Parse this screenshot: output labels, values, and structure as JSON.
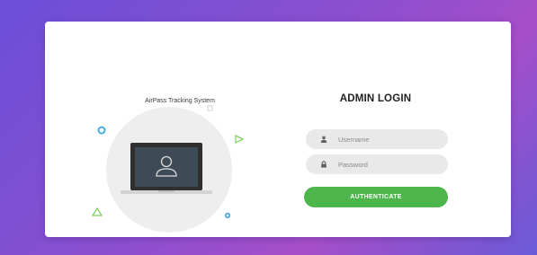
{
  "brand": {
    "name": "AirPass Tracking System"
  },
  "login": {
    "title": "ADMIN LOGIN",
    "username_placeholder": "Username",
    "password_placeholder": "Password",
    "submit_label": "AUTHENTICATE"
  },
  "icons": {
    "username": "user-icon",
    "password": "lock-icon",
    "illustration": "laptop-user-icon"
  },
  "colors": {
    "accent": "#4cb64a",
    "field_bg": "#e9e9e9",
    "background_start": "#6b4fd8",
    "background_end": "#a64ec8"
  }
}
